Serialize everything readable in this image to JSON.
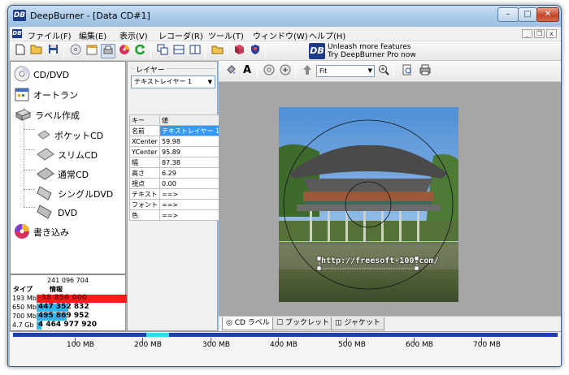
{
  "window": {
    "app_icon": "DB",
    "title": "DeepBurner - [Data CD#1]",
    "caption_minimize": "–",
    "caption_maximize": "□",
    "caption_close": "✕"
  },
  "menu": {
    "items": [
      "ファイル(F)",
      "編集(E)",
      "表示(V)",
      "レコーダ(R)",
      "ツール(T)",
      "ウィンドウ(W)",
      "ヘルプ(H)"
    ],
    "mdi_minimize": "_",
    "mdi_restore": "❐",
    "mdi_close": "x"
  },
  "promo": {
    "logo": "DB",
    "line1": "Unleash more features",
    "line2": "Try DeepBurner Pro now"
  },
  "tree": {
    "cd_dvd": "CD/DVD",
    "autorun": "オートラン",
    "label_create": "ラベル作成",
    "pocket_cd": "ポケットCD",
    "slim_cd": "スリムCD",
    "normal_cd": "通常CD",
    "single_dvd": "シングルDVD",
    "dvd": "DVD",
    "burn": "書き込み"
  },
  "disk_info": {
    "total": "241 096 704",
    "col_type": "タイプ",
    "col_info": "情報",
    "rows": [
      {
        "type": "193 Mb",
        "value": "-38 856 000",
        "color": "#ff1a1a",
        "fill": 1.0
      },
      {
        "type": "650 Mb",
        "value": "447 352 832",
        "color": "#2bb6f0",
        "fill": 0.35
      },
      {
        "type": "700 Mb",
        "value": "495 869 952",
        "color": "#2bb6f0",
        "fill": 0.33
      },
      {
        "type": "4.7 Gb",
        "value": "4 464 977 920",
        "color": "#2bb6f0",
        "fill": 0.05
      }
    ]
  },
  "layer_panel": {
    "group_label": "レイヤー",
    "selected_layer": "テキストレイヤー 1",
    "col_key": "キー",
    "col_value": "値",
    "props": [
      {
        "key": "名前",
        "value": "テキストレイヤー 1"
      },
      {
        "key": "XCenter",
        "value": "59.98"
      },
      {
        "key": "YCenter",
        "value": "95.89"
      },
      {
        "key": "幅",
        "value": "87.38"
      },
      {
        "key": "高さ",
        "value": "6.29"
      },
      {
        "key": "視点",
        "value": "0.00"
      },
      {
        "key": "テキスト",
        "value": "==>"
      },
      {
        "key": "フォント",
        "value": "==>"
      },
      {
        "key": "色",
        "value": "==>"
      }
    ]
  },
  "edit_toolbar": {
    "text_tool": "A",
    "zoom_value": "Fit"
  },
  "canvas": {
    "label_text": "http://freesoft-100.com/"
  },
  "tabs": [
    {
      "label": "CD ラベル"
    },
    {
      "label": "ブックレット"
    },
    {
      "label": "ジャケット"
    }
  ],
  "ruler": {
    "labels": [
      "100 MB",
      "200 MB",
      "300 MB",
      "400 MB",
      "500 MB",
      "600 MB",
      "700 MB"
    ],
    "used_color": "#1b3fb0",
    "overflow_color": "#35d7e8"
  }
}
